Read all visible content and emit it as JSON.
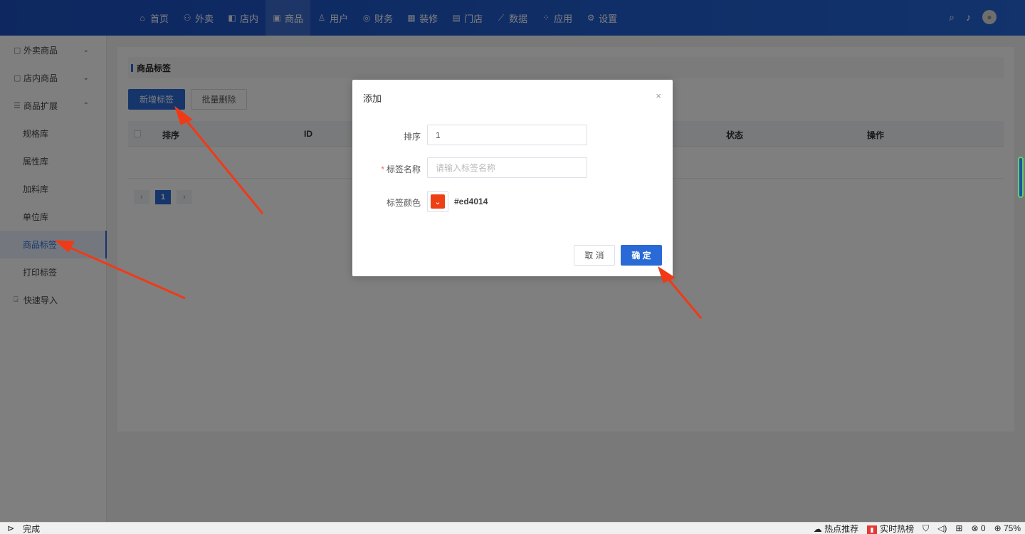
{
  "topnav": {
    "items": [
      {
        "icon": "home-icon",
        "glyph": "⌂",
        "label": "首页"
      },
      {
        "icon": "takeaway-icon",
        "glyph": "⚇",
        "label": "外卖"
      },
      {
        "icon": "store-inside-icon",
        "glyph": "◧",
        "label": "店内"
      },
      {
        "icon": "goods-icon",
        "glyph": "▣",
        "label": "商品"
      },
      {
        "icon": "user-icon",
        "glyph": "♙",
        "label": "用户"
      },
      {
        "icon": "finance-icon",
        "glyph": "◎",
        "label": "财务"
      },
      {
        "icon": "decor-icon",
        "glyph": "▦",
        "label": "装修"
      },
      {
        "icon": "shop-icon",
        "glyph": "▤",
        "label": "门店"
      },
      {
        "icon": "data-icon",
        "glyph": "⟋",
        "label": "数据"
      },
      {
        "icon": "apps-icon",
        "glyph": "⁘",
        "label": "应用"
      },
      {
        "icon": "settings-icon",
        "glyph": "⚙",
        "label": "设置"
      }
    ],
    "active_index": 3
  },
  "sidebar": {
    "items": [
      {
        "label": "外卖商品",
        "icon": "takeaway-goods-icon",
        "glyph": "▢",
        "chevron": "⌄",
        "sub": false
      },
      {
        "label": "店内商品",
        "icon": "store-goods-icon",
        "glyph": "▢",
        "chevron": "⌄",
        "sub": false
      },
      {
        "label": "商品扩展",
        "icon": "extend-icon",
        "glyph": "☰",
        "chevron": "⌃",
        "sub": false
      },
      {
        "label": "规格库",
        "sub": true
      },
      {
        "label": "属性库",
        "sub": true
      },
      {
        "label": "加料库",
        "sub": true
      },
      {
        "label": "单位库",
        "sub": true
      },
      {
        "label": "商品标签",
        "sub": true,
        "active": true
      },
      {
        "label": "打印标签",
        "sub": true
      },
      {
        "label": "快速导入",
        "icon": "import-icon",
        "glyph": "⍈",
        "sub": false
      }
    ]
  },
  "main": {
    "section_title": "商品标签",
    "add_button": "新增标签",
    "batch_delete_button": "批量删除",
    "table_headers": [
      "排序",
      "ID",
      "状态",
      "操作"
    ],
    "pagination": {
      "prev": "‹",
      "current": "1",
      "next": "›"
    }
  },
  "dialog": {
    "title": "添加",
    "close": "×",
    "sort_label": "排序",
    "sort_value": "1",
    "name_required": "*",
    "name_label": "标签名称",
    "name_placeholder": "请输入标签名称",
    "color_label": "标签颜色",
    "color_value": "#ed4014",
    "color_hex": "#ed4014",
    "cancel": "取 消",
    "ok": "确 定"
  },
  "statusbar": {
    "done": "完成",
    "hot_recommend": "热点推荐",
    "realtime_hot": "实时热榜",
    "count": "0",
    "zoom": "75%"
  }
}
